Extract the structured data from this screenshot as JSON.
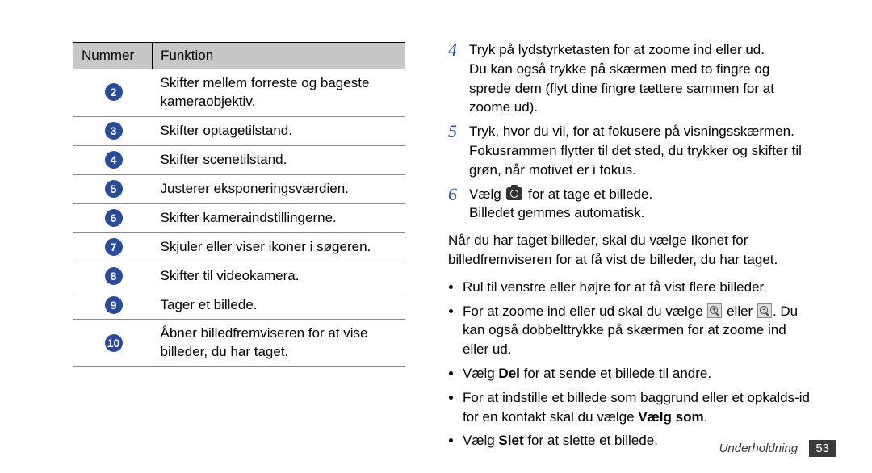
{
  "table": {
    "headers": {
      "num": "Nummer",
      "func": "Funktion"
    },
    "rows": [
      {
        "n": "2",
        "f": "Skifter mellem forreste og bageste kameraobjektiv."
      },
      {
        "n": "3",
        "f": "Skifter optagetilstand."
      },
      {
        "n": "4",
        "f": "Skifter scenetilstand."
      },
      {
        "n": "5",
        "f": "Justerer eksponeringsværdien."
      },
      {
        "n": "6",
        "f": "Skifter kameraindstillingerne."
      },
      {
        "n": "7",
        "f": "Skjuler eller viser ikoner i søgeren."
      },
      {
        "n": "8",
        "f": "Skifter til videokamera."
      },
      {
        "n": "9",
        "f": "Tager et billede."
      },
      {
        "n": "10",
        "f": "Åbner billedfremviseren for at vise billeder, du har taget."
      }
    ]
  },
  "steps": {
    "s4": {
      "num": "4",
      "l1": "Tryk på lydstyrketasten for at zoome ind eller ud.",
      "l2": "Du kan også trykke på skærmen med to fingre og sprede dem (flyt dine fingre tættere sammen for at zoome ud)."
    },
    "s5": {
      "num": "5",
      "l1": "Tryk, hvor du vil, for at fokusere på visningsskærmen.",
      "l2": "Fokusrammen flytter til det sted, du trykker og skifter til grøn, når motivet er i fokus."
    },
    "s6": {
      "num": "6",
      "pre": "Vælg ",
      "post": " for at tage et billede.",
      "l2": "Billedet gemmes automatisk."
    }
  },
  "para_after": "Når du har taget billeder, skal du vælge Ikonet for billedfremviseren for at få vist de billeder, du har taget.",
  "bullets": {
    "b1": "Rul til venstre eller højre for at få vist flere billeder.",
    "b2": {
      "pre": "For at zoome ind eller ud skal du vælge ",
      "mid": " eller ",
      "post": ". Du kan også dobbelttrykke på skærmen for at zoome ind eller ud."
    },
    "b3": {
      "pre": "Vælg ",
      "bold": "Del",
      "post": " for at sende et billede til andre."
    },
    "b4": {
      "pre": "For at indstille et billede som baggrund eller et opkalds-id for en kontakt skal du vælge ",
      "bold": "Vælg som",
      "post": "."
    },
    "b5": {
      "pre": "Vælg ",
      "bold": "Slet",
      "post": " for at slette et billede."
    }
  },
  "footer": {
    "section": "Underholdning",
    "page": "53"
  }
}
